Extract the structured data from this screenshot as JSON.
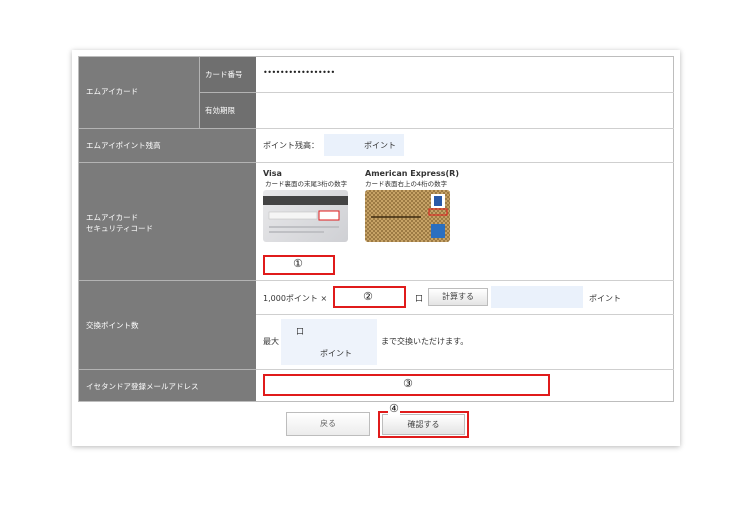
{
  "form": {
    "card_header": "エムアイカード",
    "card_number_label": "カード番号",
    "card_number_value": "•••••••••••••••••",
    "expiry_label": "有効期限",
    "points_header": "エムアイポイント残高",
    "points_label": "ポイント残高：",
    "points_unit": "ポイント",
    "security_header_line1": "エムアイカード",
    "security_header_line2": "セキュリティコード",
    "visa_title": "Visa",
    "visa_caption": "カード裏面の末尾3桁の数字",
    "amex_title": "American Express(R)",
    "amex_caption": "カード表面右上の4桁の数字",
    "exchange_header": "交換ポイント数",
    "exchange_multiplier": "1,000ポイント ×",
    "exchange_unit": "口",
    "calc_button": "計算する",
    "result_unit": "ポイント",
    "max_label": "最大",
    "max_unit_kou": "口",
    "max_unit_point": "ポイント",
    "max_suffix": "まで交換いただけます。",
    "email_header": "イセタンドア登録メールアドレス",
    "back_button": "戻る",
    "confirm_button": "確認する"
  },
  "annotations": {
    "marker_1": "①",
    "marker_2": "②",
    "marker_3": "③",
    "marker_4": "④"
  },
  "colors": {
    "header_bg": "#7b7b7b",
    "highlight_red": "#e01b1b",
    "input_tint": "#eaf1fb"
  }
}
